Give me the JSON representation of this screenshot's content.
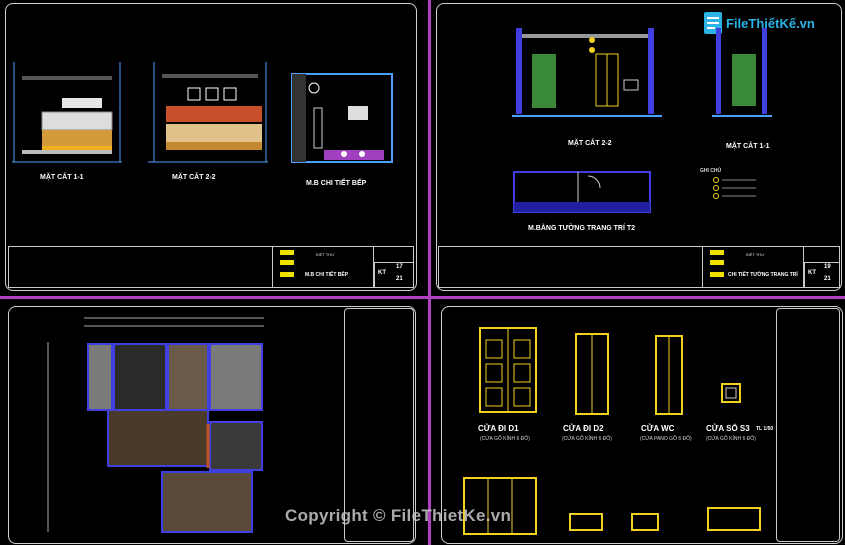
{
  "logo": {
    "text": "FileThiếtKế.vn"
  },
  "watermark": "Copyright © FileThietKe.vn",
  "sheets": {
    "tl": {
      "title_small": "MẶT CẮT 1-1",
      "title_mid": "MẶT CẮT 2-2",
      "title_right": "M.B CHI TIẾT BẾP",
      "tb_line1": "BIỆT THỰ",
      "tb_line2": "M.B CHI TIẾT BẾP",
      "tb_code": "KT",
      "tb_num1": "17",
      "tb_num2": "21"
    },
    "tr": {
      "title_a": "MẶT CẮT 2-2",
      "title_b": "MẶT CẮT 1-1",
      "title_c": "M.BẰNG TƯỜNG TRANG TRÍ T2",
      "notes_title": "GHI CHÚ",
      "tb_line1": "BIỆT THỰ",
      "tb_line2": "CHI TIẾT TƯỜNG TRANG TRÍ",
      "tb_code": "KT",
      "tb_num1": "19",
      "tb_num2": "21"
    },
    "br": {
      "d1": "CỬA ĐI D1",
      "d1_sub": "(CỬA GỖ KÍNH 6 ĐỐ)",
      "d2": "CỬA ĐI D2",
      "d2_sub": "(CỬA GỖ KÍNH 6 ĐỐ)",
      "wc": "CỬA WC",
      "wc_sub": "(CỬA PANO GỖ 6 ĐỐ)",
      "s3": "CỬA SỔ S3",
      "s3_sub": "(CỬA GỖ KÍNH 6 ĐỐ)",
      "scale": "TL 1/50"
    }
  }
}
